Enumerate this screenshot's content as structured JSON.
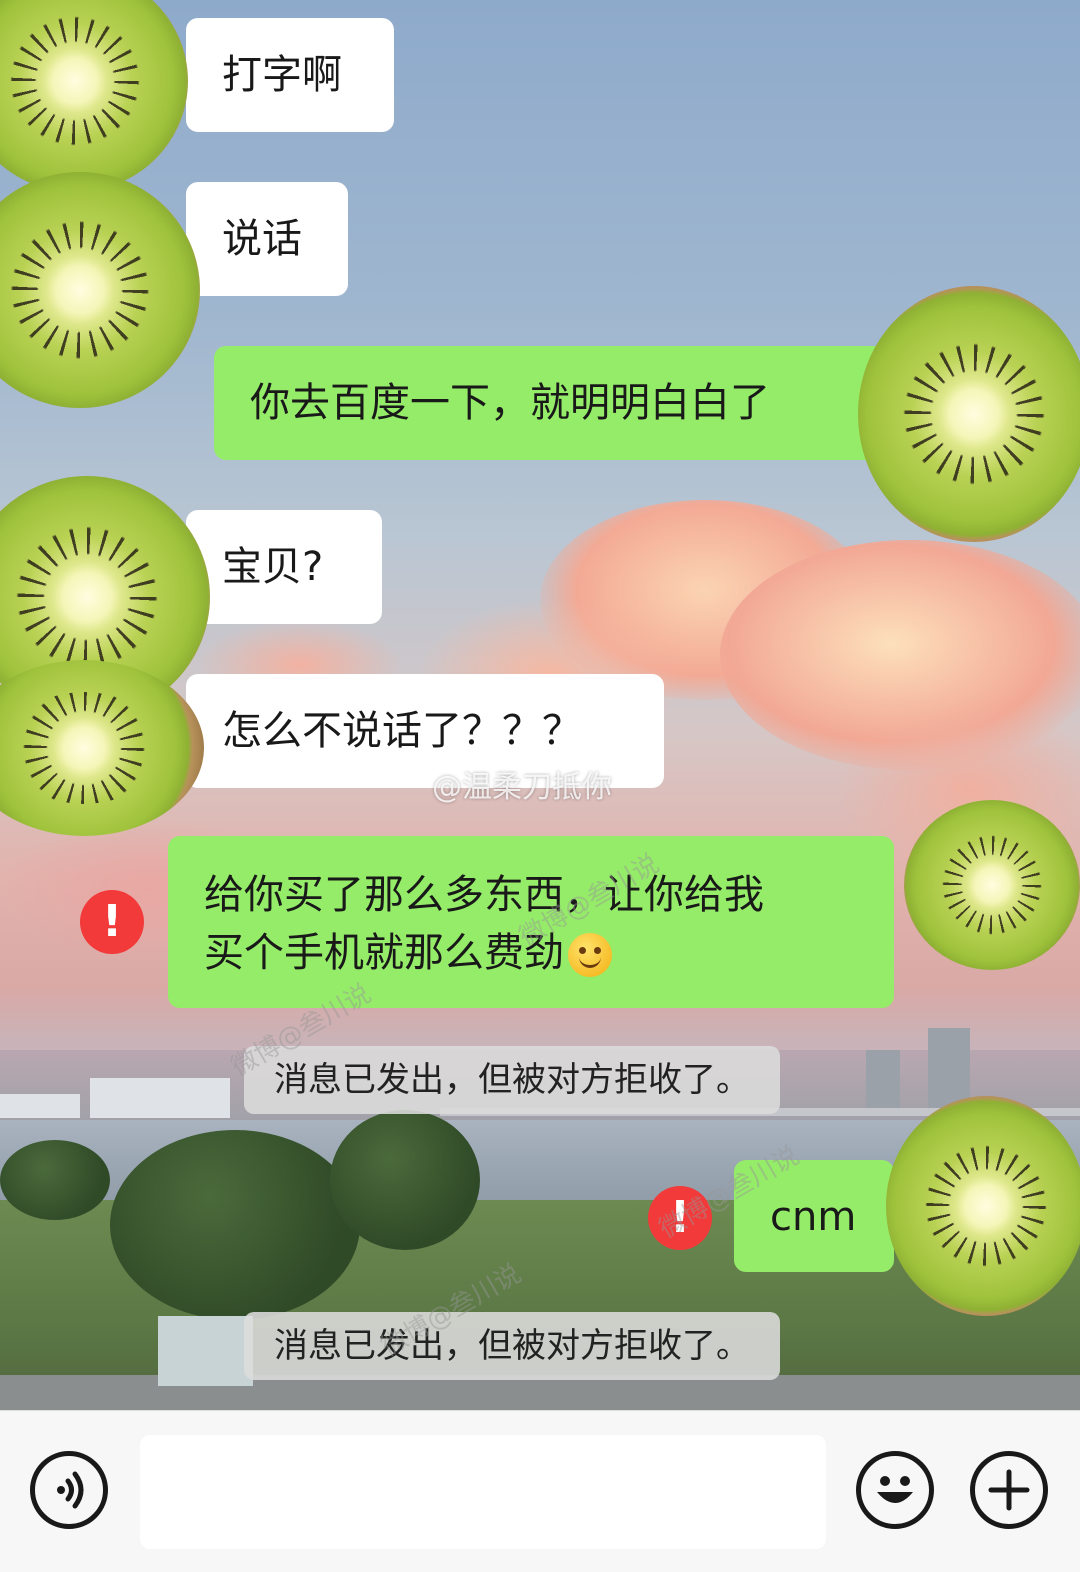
{
  "messages": [
    {
      "side": "left",
      "text": "打字啊"
    },
    {
      "side": "left",
      "text": "说话"
    },
    {
      "side": "right",
      "text": "你去百度一下，就明明白白了"
    },
    {
      "side": "left",
      "text": "宝贝?"
    },
    {
      "side": "left",
      "text": "怎么不说话了？？？"
    },
    {
      "side": "right",
      "status": "failed",
      "line1": "给你买了那么多东西，让你给我",
      "line2": "买个手机就那么费劲"
    },
    {
      "side": "system",
      "text": "消息已发出，但被对方拒收了。"
    },
    {
      "side": "right",
      "status": "failed",
      "text": "cnm"
    },
    {
      "side": "system",
      "text": "消息已发出，但被对方拒收了。"
    }
  ],
  "icons": {
    "error": "!",
    "emoji_in_message": "smiley-emoji",
    "avatar": "kiwi"
  },
  "watermarks": {
    "weibo_user": "@温柔刀抵你",
    "diagonal": "微博@叁川说"
  },
  "input_bar": {
    "voice_icon": "voice-icon",
    "emoji_icon": "emoji-icon",
    "more_icon": "plus-icon",
    "text_value": ""
  },
  "colors": {
    "sent_bubble": "#95ec69",
    "received_bubble": "#ffffff",
    "error_badge": "#f23a3a",
    "system_notice": "#dcdcdc"
  }
}
